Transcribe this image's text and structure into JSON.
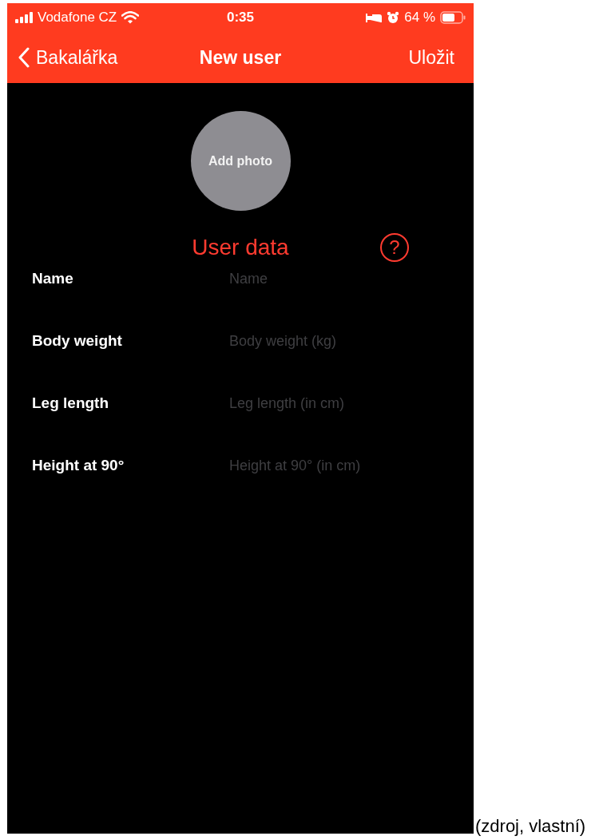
{
  "status_bar": {
    "carrier": "Vodafone CZ",
    "time": "0:35",
    "battery": "64 %"
  },
  "nav_bar": {
    "back": "Bakalářka",
    "title": "New user",
    "action": "Uložit"
  },
  "photo_button": {
    "label": "Add photo"
  },
  "section": {
    "title": "User data",
    "help": "?"
  },
  "fields": [
    {
      "label": "Name",
      "placeholder": "Name"
    },
    {
      "label": "Body weight",
      "placeholder": "Body weight (kg)"
    },
    {
      "label": "Leg length",
      "placeholder": "Leg length (in cm)"
    },
    {
      "label": "Height at 90°",
      "placeholder": "Height at 90° (in cm)"
    }
  ],
  "caption": "(zdroj, vlastní)"
}
